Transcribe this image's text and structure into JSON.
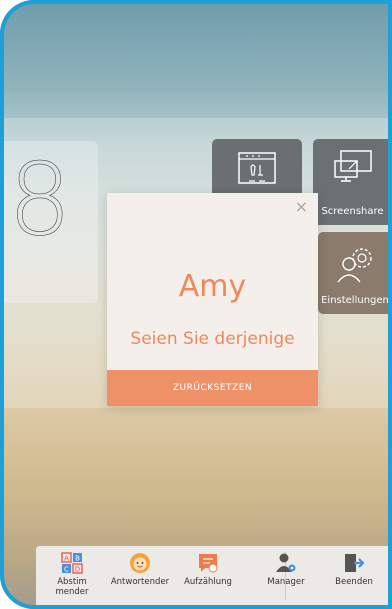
{
  "clock": {
    "digit": "8"
  },
  "tiles": {
    "screenshare_label": "Screenshare",
    "settings_label": "Einstellungen",
    "whiteboard_icon": "whiteboard-icon",
    "screenshare_icon": "monitor-icon",
    "settings_icon": "gear-user-icon"
  },
  "dialog": {
    "close_glyph": "×",
    "name": "Amy",
    "subtitle": "Seien Sie derjenige",
    "button_label": "ZURÜCKSETZEN"
  },
  "toolbar": {
    "items": [
      {
        "label": "Abstim\nmender",
        "icon": "abcd-vote-icon"
      },
      {
        "label": "Antwortender",
        "icon": "smiley-responder-icon"
      },
      {
        "label": "Aufzählung",
        "icon": "chat-list-icon"
      },
      {
        "label": "Manager",
        "icon": "user-gear-icon"
      },
      {
        "label": "Beenden",
        "icon": "exit-icon"
      }
    ]
  },
  "colors": {
    "accent": "#ec8a5b",
    "button": "#ee9168",
    "frame_border": "#1e9fd8",
    "vote_red": "#e2504e",
    "vote_blue": "#4a8fd8"
  }
}
